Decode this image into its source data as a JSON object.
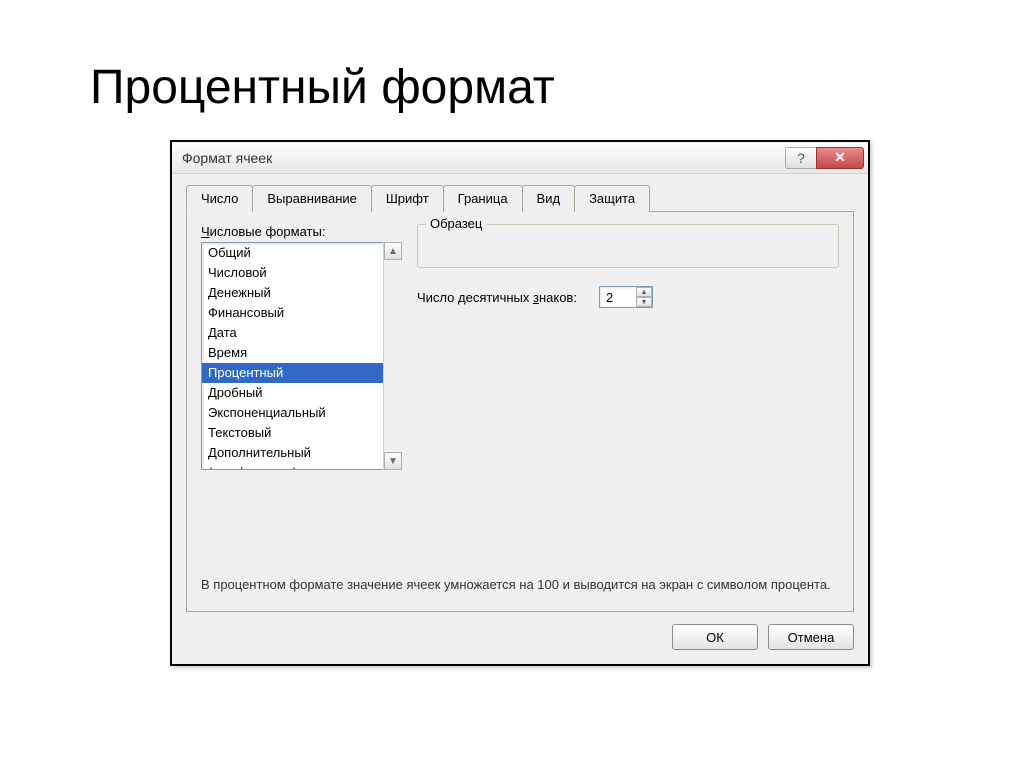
{
  "slide": {
    "title": "Процентный формат"
  },
  "dialog": {
    "title": "Формат ячеек",
    "tabs": {
      "number": "Число",
      "alignment": "Выравнивание",
      "font": "Шрифт",
      "border": "Граница",
      "view": "Вид",
      "protection": "Защита"
    },
    "category_label_prefix": "Ч",
    "category_label_rest": "исловые форматы:",
    "categories": [
      "Общий",
      "Числовой",
      "Денежный",
      "Финансовый",
      "Дата",
      "Время",
      "Процентный",
      "Дробный",
      "Экспоненциальный",
      "Текстовый",
      "Дополнительный",
      "(все форматы)"
    ],
    "selected_category_index": 6,
    "sample_label": "Образец",
    "decimal_label_prefix": "Число десятичных ",
    "decimal_underline": "з",
    "decimal_label_suffix": "наков:",
    "decimal_value": "2",
    "description": "В процентном формате значение ячеек умножается на 100 и выводится на экран с символом процента.",
    "buttons": {
      "ok": "ОК",
      "cancel": "Отмена"
    }
  }
}
